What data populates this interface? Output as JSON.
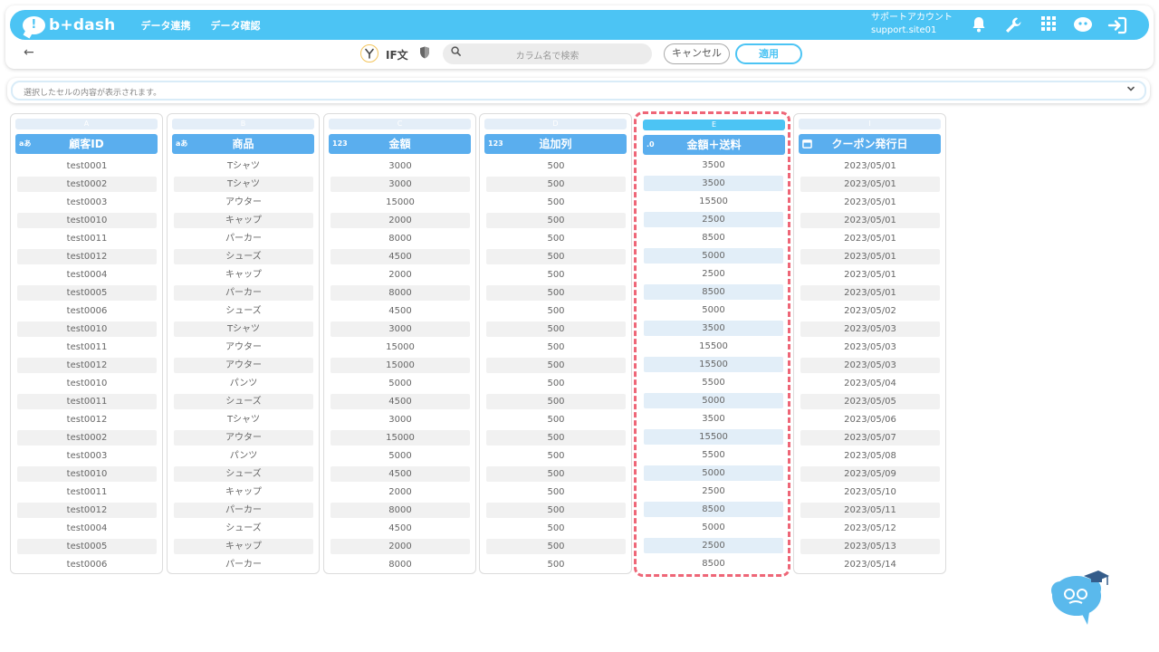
{
  "header": {
    "logo_text": "b+dash",
    "logo_mark": "!",
    "nav": [
      "データ連携",
      "データ確認"
    ],
    "account_name": "サポートアカウント",
    "account_id": "support.site01",
    "icons": [
      "bell-icon",
      "wrench-icon",
      "grid-icon",
      "mascot-icon",
      "logout-icon"
    ]
  },
  "toolbar": {
    "back_icon": "arrow-left-icon",
    "if_label": "IF文",
    "search_placeholder": "カラム名で検索",
    "cancel_label": "キャンセル",
    "apply_label": "適用"
  },
  "cell_preview": {
    "text": "選択したセルの内容が表示されます。"
  },
  "columns": [
    {
      "letter": "A",
      "type_icon": "aあ",
      "name": "顧客ID",
      "values": [
        "test0001",
        "test0002",
        "test0003",
        "test0010",
        "test0011",
        "test0012",
        "test0004",
        "test0005",
        "test0006",
        "test0010",
        "test0011",
        "test0012",
        "test0010",
        "test0011",
        "test0012",
        "test0002",
        "test0003",
        "test0010",
        "test0011",
        "test0012",
        "test0004",
        "test0005",
        "test0006"
      ]
    },
    {
      "letter": "B",
      "type_icon": "aあ",
      "name": "商品",
      "values": [
        "Tシャツ",
        "Tシャツ",
        "アウター",
        "キャップ",
        "パーカー",
        "シューズ",
        "キャップ",
        "パーカー",
        "シューズ",
        "Tシャツ",
        "アウター",
        "アウター",
        "パンツ",
        "シューズ",
        "Tシャツ",
        "アウター",
        "パンツ",
        "シューズ",
        "キャップ",
        "パーカー",
        "シューズ",
        "キャップ",
        "パーカー"
      ]
    },
    {
      "letter": "C",
      "type_icon": "123",
      "name": "金額",
      "values": [
        "3000",
        "3000",
        "15000",
        "2000",
        "8000",
        "4500",
        "2000",
        "8000",
        "4500",
        "3000",
        "15000",
        "15000",
        "5000",
        "4500",
        "3000",
        "15000",
        "5000",
        "4500",
        "2000",
        "8000",
        "4500",
        "2000",
        "8000"
      ]
    },
    {
      "letter": "D",
      "type_icon": "123",
      "name": "追加列",
      "values": [
        "500",
        "500",
        "500",
        "500",
        "500",
        "500",
        "500",
        "500",
        "500",
        "500",
        "500",
        "500",
        "500",
        "500",
        "500",
        "500",
        "500",
        "500",
        "500",
        "500",
        "500",
        "500",
        "500"
      ]
    },
    {
      "letter": "E",
      "type_icon": ".0",
      "name": "金額＋送料",
      "values": [
        "3500",
        "3500",
        "15500",
        "2500",
        "8500",
        "5000",
        "2500",
        "8500",
        "5000",
        "3500",
        "15500",
        "15500",
        "5500",
        "5000",
        "3500",
        "15500",
        "5500",
        "5000",
        "2500",
        "8500",
        "5000",
        "2500",
        "8500"
      ]
    },
    {
      "letter": "I",
      "type_icon": "calendar-icon",
      "name": "クーポン発行日",
      "values": [
        "2023/05/01",
        "2023/05/01",
        "2023/05/01",
        "2023/05/01",
        "2023/05/01",
        "2023/05/01",
        "2023/05/01",
        "2023/05/01",
        "2023/05/02",
        "2023/05/03",
        "2023/05/03",
        "2023/05/03",
        "2023/05/04",
        "2023/05/05",
        "2023/05/06",
        "2023/05/07",
        "2023/05/08",
        "2023/05/09",
        "2023/05/10",
        "2023/05/11",
        "2023/05/12",
        "2023/05/13",
        "2023/05/14"
      ]
    }
  ],
  "colors": {
    "brand": "#4cc4f4",
    "header_cell": "#5aaeee",
    "highlight_border": "#ee6677"
  }
}
